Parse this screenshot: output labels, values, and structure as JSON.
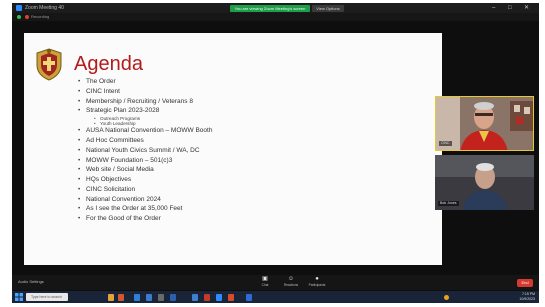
{
  "window": {
    "title": "Zoom Meeting 40",
    "sharing_banner": "You are viewing Zoom Meeting's screen",
    "view_options": "View Options",
    "controls": [
      "–",
      "□",
      "✕"
    ]
  },
  "subbar": {
    "label": "Recording"
  },
  "slide": {
    "title": "Agenda",
    "items": [
      {
        "text": "The Order",
        "sub": []
      },
      {
        "text": "CINC Intent",
        "sub": []
      },
      {
        "text": "Membership / Recruiting / Veterans 8",
        "sub": []
      },
      {
        "text": "Strategic Plan 2023-2028",
        "sub": [
          "Outreach Programs",
          "Youth Leadership"
        ]
      },
      {
        "text": "AUSA National Convention – MOWW Booth",
        "sub": []
      },
      {
        "text": "Ad Hoc Committees",
        "sub": []
      },
      {
        "text": "National Youth Civics Summit / WA, DC",
        "sub": []
      },
      {
        "text": "MOWW Foundation – 501(c)3",
        "sub": []
      },
      {
        "text": "Web site / Social Media",
        "sub": []
      },
      {
        "text": "HQs Objectives",
        "sub": []
      },
      {
        "text": "CINC Solicitation",
        "sub": []
      },
      {
        "text": "National Convention 2024",
        "sub": []
      },
      {
        "text": "As I see the Order at 35,000 Feet",
        "sub": []
      },
      {
        "text": "For the Good of the Order",
        "sub": []
      }
    ]
  },
  "participants": [
    {
      "name": "CINC",
      "active_speaker": true
    },
    {
      "name": "Bob Jones",
      "active_speaker": false
    }
  ],
  "controls_bar": {
    "left_label": "Audio Settings",
    "buttons": [
      {
        "icon": "chat-icon",
        "label": "Chat"
      },
      {
        "icon": "reactions-icon",
        "label": "Reactions"
      },
      {
        "icon": "participants-icon",
        "label": "Participants"
      }
    ],
    "end_label": "End"
  },
  "taskbar": {
    "search_placeholder": "Type here to search",
    "time": "7:15 PM",
    "date": "10/9/2023"
  },
  "colors": {
    "agenda_title": "#b31b1b",
    "active_speaker_border": "#e5c832",
    "share_banner": "#1f9e4a",
    "end_button": "#d43a2f"
  }
}
